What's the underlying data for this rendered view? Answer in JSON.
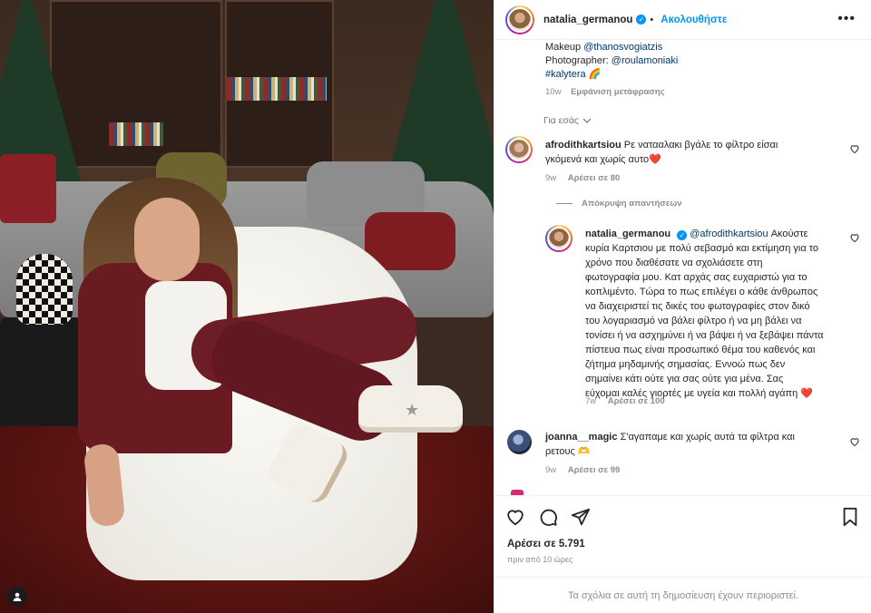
{
  "header": {
    "username": "natalia_germanou",
    "follow_label": "Ακολουθήστε",
    "more_label": "•••"
  },
  "caption": {
    "makeup_prefix": "Makeup",
    "makeup_handle": "@thanosvogiatzis",
    "photographer_prefix": "Photographer:",
    "photographer_handle": "@roulamoniaki",
    "hashtag": "#kalytera",
    "emoji": "🌈",
    "age": "10w",
    "translate_label": "Εμφάνιση μετάφρασης"
  },
  "for_you": "Για εσάς",
  "comments": [
    {
      "username": "afrodithkartsiou",
      "text_line1": "Ρε νατααλακι βγάλε το φίλτρο είσαι",
      "text_line2": "γκόμενά και χωρίς αυτο",
      "emoji": "❤️",
      "age": "9w",
      "likes": "Αρέσει σε 80"
    }
  ],
  "hide_replies_label": "Απόκρυψη απαντήσεων",
  "reply": {
    "username": "natalia_germanou",
    "mention": "@afrodithkartsiou",
    "first": "Ακούστε",
    "lines": [
      "κυρία Καρτσιου με πολύ σεβασμό και εκτίμηση για το",
      "χρόνο που διαθέσατε να σχολιάσετε στη",
      "φωτογραφία μου. Κατ αρχάς σας ευχαριστώ για το",
      "κοπλιμέντο. Τώρα το πως επιλέγει ο κάθε άνθρωπος",
      "να διαχειριστεί τις δικές του φωτογραφίες στον δικό",
      "του λογαριασμό να βάλει φίλτρο ή να μη βάλει να",
      "τονίσει ή να ασχημύνει ή να βάψει ή να ξεβάψει πάντα",
      "πίστευα πως είναι προσωπικό θέμα του καθενός και",
      "ζήτημα μηδαμινής σημασίας. Εννοώ πως δεν",
      "σημαίνει κάτι ούτε για σας ούτε για μένα. Σας",
      "εύχομαι καλές γιορτές με υγεία και πολλή αγάπη"
    ],
    "emoji": "❤️",
    "age": "7w",
    "likes": "Αρέσει σε 100"
  },
  "comment2": {
    "username": "joanna__magic",
    "text_line1": "Σ'αγαπαμε και χωρίς αυτά τα φίλτρα και",
    "text_line2": "ρετους 🫶",
    "age": "9w",
    "likes": "Αρέσει σε 99"
  },
  "footer": {
    "likes": "Αρέσει σε 5.791",
    "time": "πριν από 10 ώρες",
    "restricted": "Τα σχόλια σε αυτή τη δημοσίευση έχουν περιοριστεί."
  },
  "colors": {
    "accent": "#0095f6",
    "heart": "#ed4956",
    "muted": "#8e8e8e"
  }
}
